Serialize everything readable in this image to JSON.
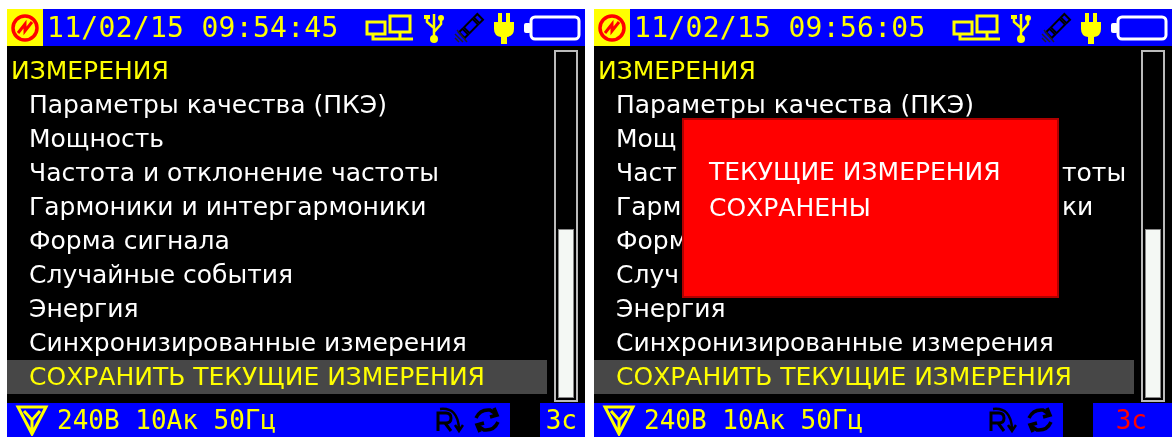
{
  "screens": [
    {
      "status_bar": {
        "datetime": "11/02/15 09:54:45"
      },
      "menu": {
        "title": "ИЗМЕРЕНИЯ",
        "items": [
          {
            "label": "Параметры качества (ПКЭ)",
            "selected": false
          },
          {
            "label": "Мощность",
            "selected": false
          },
          {
            "label": "Частота и отклонение частоты",
            "selected": false
          },
          {
            "label": "Гармоники и интергармоники",
            "selected": false
          },
          {
            "label": "Форма сигнала",
            "selected": false
          },
          {
            "label": "Случайные события",
            "selected": false
          },
          {
            "label": "Энергия",
            "selected": false
          },
          {
            "label": "Синхронизированные измерения",
            "selected": false
          },
          {
            "label": "СОХРАНИТЬ ТЕКУЩИЕ ИЗМЕРЕНИЯ",
            "selected": true
          }
        ]
      },
      "bottom_bar": {
        "readings": "240В 10Ак 50Гц",
        "timer": "3с",
        "timer_alert": false
      }
    },
    {
      "status_bar": {
        "datetime": "11/02/15 09:56:05"
      },
      "menu": {
        "title": "ИЗМЕРЕНИЯ",
        "items": [
          {
            "label": "Параметры качества (ПКЭ)",
            "selected": false
          },
          {
            "label": "Мощ",
            "selected": false
          },
          {
            "label": "Част",
            "label_right": "тоты",
            "selected": false
          },
          {
            "label": "Гарм",
            "label_right": "ки",
            "selected": false
          },
          {
            "label": "Форм",
            "selected": false
          },
          {
            "label": "Случ",
            "selected": false
          },
          {
            "label": "Энергия",
            "selected": false
          },
          {
            "label": "Синхронизированные измерения",
            "selected": false
          },
          {
            "label": "СОХРАНИТЬ ТЕКУЩИЕ ИЗМЕРЕНИЯ",
            "selected": true
          }
        ]
      },
      "popup": {
        "message": "ТЕКУЩИЕ ИЗМЕРЕНИЯ\nСОХРАНЕНЫ"
      },
      "bottom_bar": {
        "readings": "240В 10Ак 50Гц",
        "timer": "3с",
        "timer_alert": true
      }
    }
  ]
}
